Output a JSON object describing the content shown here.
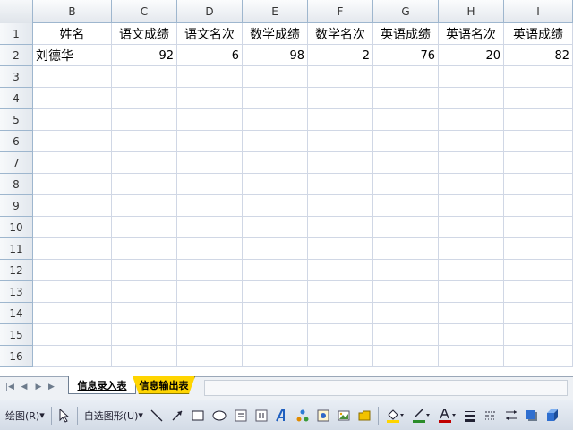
{
  "columns": [
    "B",
    "C",
    "D",
    "E",
    "F",
    "G",
    "H",
    "I"
  ],
  "row_numbers": [
    "1",
    "2",
    "3",
    "4",
    "5",
    "6",
    "7",
    "8",
    "9",
    "10",
    "11",
    "12",
    "13",
    "14",
    "15",
    "16"
  ],
  "header_cells": [
    "姓名",
    "语文成绩",
    "语文名次",
    "数学成绩",
    "数学名次",
    "英语成绩",
    "英语名次",
    "英语成绩"
  ],
  "data_row": [
    "刘德华",
    "92",
    "6",
    "98",
    "2",
    "76",
    "20",
    "82"
  ],
  "tabs": {
    "active": "信息录入表",
    "other": "信息输出表"
  },
  "toolbar": {
    "draw_label": "绘图(R)",
    "autoshape_label": "自选图形(U)"
  },
  "colors": {
    "tab_yellow": "#ffd500",
    "font_color_bar": "#c00000",
    "fill_color_bar": "#ffd500",
    "line_color_bar": "#2a8c2a"
  }
}
